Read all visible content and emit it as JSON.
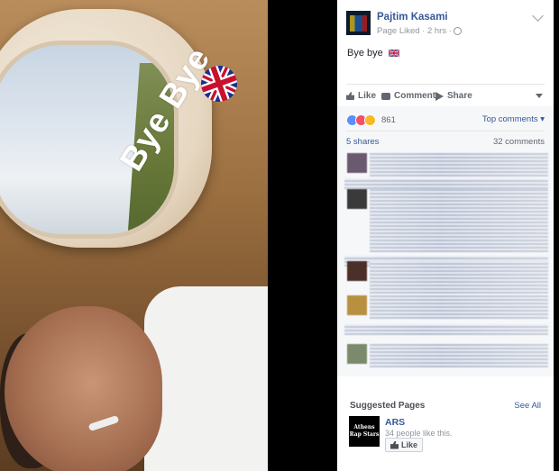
{
  "photo": {
    "caption": "Bye Bye"
  },
  "post": {
    "author": "Pajtim Kasami",
    "meta": "Page Liked · 2 hrs ·",
    "text": "Bye bye",
    "actions": {
      "like": "Like",
      "comment": "Comment",
      "share": "Share"
    },
    "reaction_count": "861",
    "top_comments": "Top comments ▾",
    "shares": "5 shares",
    "comments_count": "32 comments"
  },
  "suggested": {
    "title": "Suggested Pages",
    "see_all": "See All",
    "page": {
      "logo_text": "Athens Rap Stars",
      "name": "ARS",
      "likes": "34 people like this.",
      "like_button": "Like"
    }
  },
  "colors": {
    "link": "#365899",
    "like_reaction": "#5890ff",
    "love_reaction": "#f25268",
    "wow_reaction": "#f7b928"
  }
}
